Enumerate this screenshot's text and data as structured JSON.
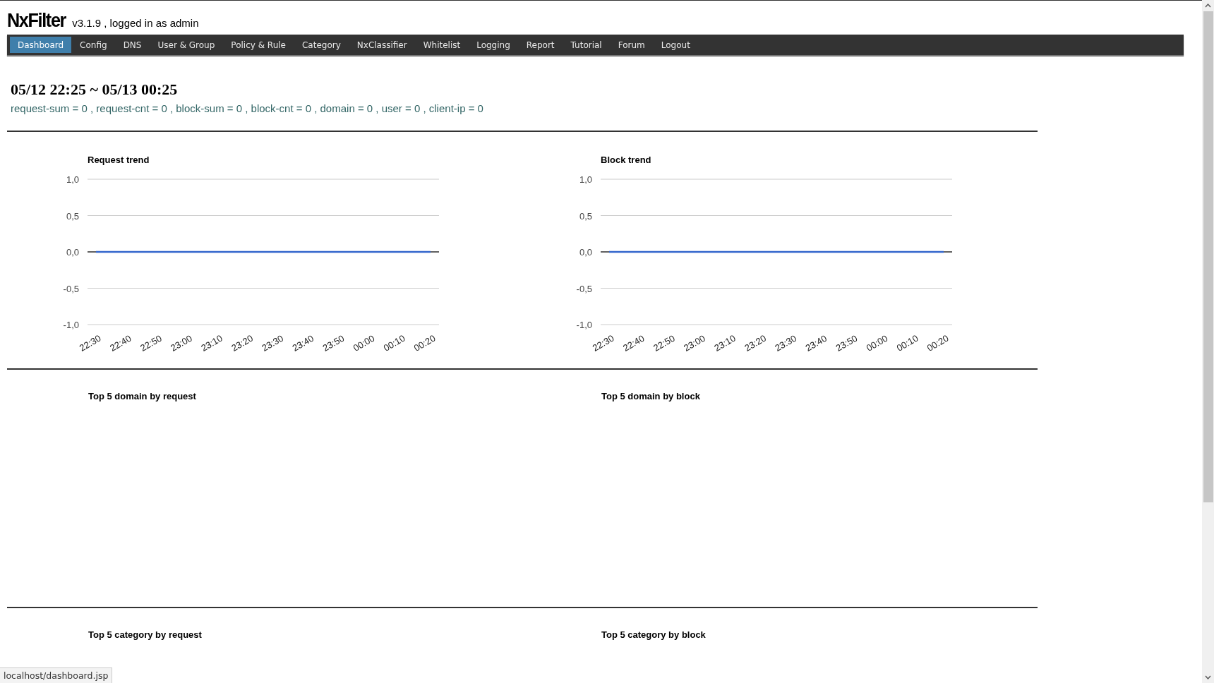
{
  "header": {
    "logo": "NxFilter",
    "subtitle": "v3.1.9 , logged in as admin"
  },
  "nav": [
    {
      "label": "Dashboard",
      "selected": true
    },
    {
      "label": "Config",
      "selected": false
    },
    {
      "label": "DNS",
      "selected": false
    },
    {
      "label": "User & Group",
      "selected": false
    },
    {
      "label": "Policy & Rule",
      "selected": false
    },
    {
      "label": "Category",
      "selected": false
    },
    {
      "label": "NxClassifier",
      "selected": false
    },
    {
      "label": "Whitelist",
      "selected": false
    },
    {
      "label": "Logging",
      "selected": false
    },
    {
      "label": "Report",
      "selected": false
    },
    {
      "label": "Tutorial",
      "selected": false
    },
    {
      "label": "Forum",
      "selected": false
    },
    {
      "label": "Logout",
      "selected": false
    }
  ],
  "period": "05/12 22:25 ~ 05/13 00:25",
  "summary": "request-sum = 0 , request-cnt = 0 , block-sum = 0 , block-cnt = 0 , domain = 0 , user = 0 , client-ip = 0",
  "charts": [
    {
      "chart_data": {
        "type": "line",
        "grid": true,
        "title": "Request trend",
        "categories": [
          "22:30",
          "22:40",
          "22:50",
          "23:00",
          "23:10",
          "23:20",
          "23:30",
          "23:40",
          "23:50",
          "00:00",
          "00:10",
          "00:20"
        ],
        "series": [
          {
            "color": "#3366cc",
            "values": [
              0,
              0,
              0,
              0,
              0,
              0,
              0,
              0,
              0,
              0,
              0,
              0
            ]
          }
        ],
        "ylim": [
          -1,
          1
        ],
        "yticks": [
          {
            "value": 1,
            "label": "1,0"
          },
          {
            "value": 0.5,
            "label": "0,5"
          },
          {
            "value": 0,
            "label": "0,0"
          },
          {
            "value": -0.5,
            "label": "-0,5"
          },
          {
            "value": -1,
            "label": "-1,0"
          }
        ]
      }
    },
    {
      "chart_data": {
        "type": "line",
        "grid": true,
        "title": "Block trend",
        "categories": [
          "22:30",
          "22:40",
          "22:50",
          "23:00",
          "23:10",
          "23:20",
          "23:30",
          "23:40",
          "23:50",
          "00:00",
          "00:10",
          "00:20"
        ],
        "series": [
          {
            "color": "#3366cc",
            "values": [
              0,
              0,
              0,
              0,
              0,
              0,
              0,
              0,
              0,
              0,
              0,
              0
            ]
          }
        ],
        "ylim": [
          -1,
          1
        ],
        "yticks": [
          {
            "value": 1,
            "label": "1,0"
          },
          {
            "value": 0.5,
            "label": "0,5"
          },
          {
            "value": 0,
            "label": "0,0"
          },
          {
            "value": -0.5,
            "label": "-0,5"
          },
          {
            "value": -1,
            "label": "-1,0"
          }
        ]
      }
    }
  ],
  "sections": [
    {
      "titles": [
        "Top 5 domain by request",
        "Top 5 domain by block"
      ]
    },
    {
      "titles": [
        "Top 5 category by request",
        "Top 5 category by block"
      ]
    }
  ],
  "status_bar": "localhost/dashboard.jsp"
}
